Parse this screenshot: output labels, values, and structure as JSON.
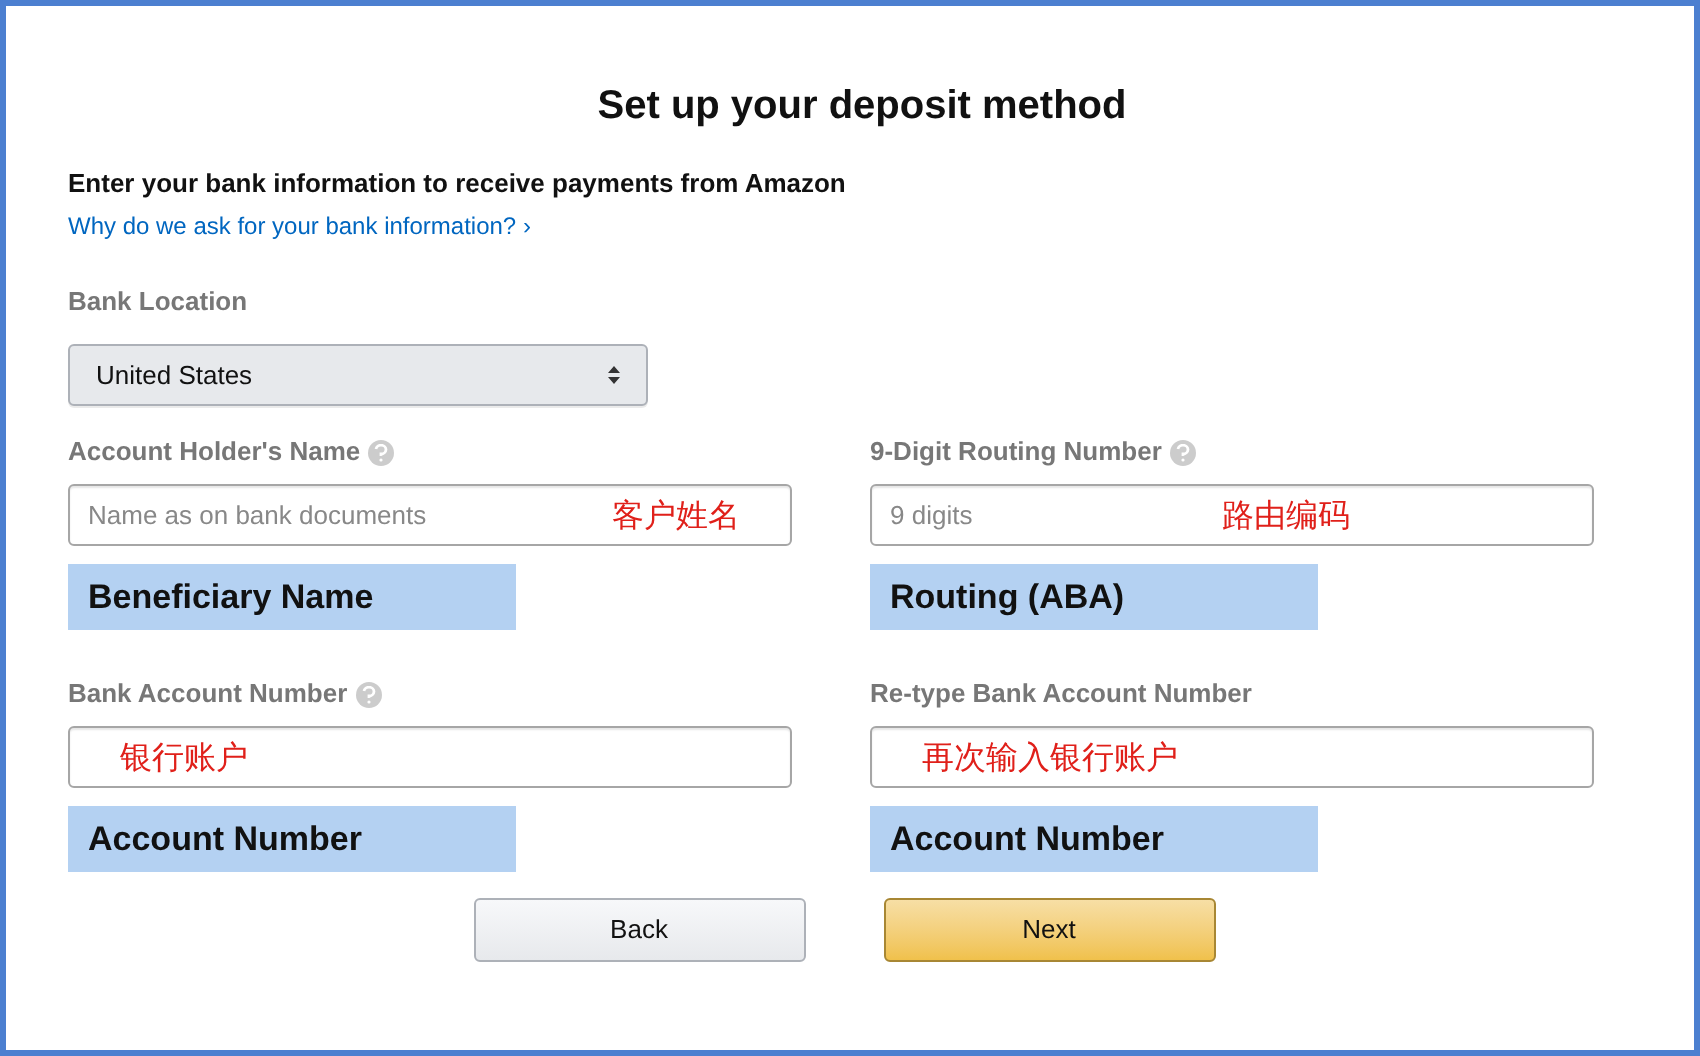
{
  "title": "Set up your deposit method",
  "intro": "Enter your bank information to receive payments from Amazon",
  "help_link": "Why do we ask for your bank information? ›",
  "bank_location": {
    "label": "Bank Location",
    "value": "United States"
  },
  "fields": [
    {
      "label": "Account Holder's Name",
      "help": true,
      "placeholder": "Name as on bank documents",
      "annotation": "客户姓名",
      "tag": "Beneficiary Name"
    },
    {
      "label": "9-Digit Routing Number",
      "help": true,
      "placeholder": "9 digits",
      "annotation": "路由编码",
      "tag": "Routing (ABA)"
    },
    {
      "label": "Bank Account Number",
      "help": true,
      "annotation": "银行账户",
      "tag": "Account Number"
    },
    {
      "label": "Re-type Bank Account Number",
      "help": false,
      "annotation": "再次输入银行账户",
      "tag": "Account Number"
    }
  ],
  "buttons": [
    {
      "label": "Back",
      "kind": "secondary"
    },
    {
      "label": "Next",
      "kind": "primary"
    }
  ]
}
